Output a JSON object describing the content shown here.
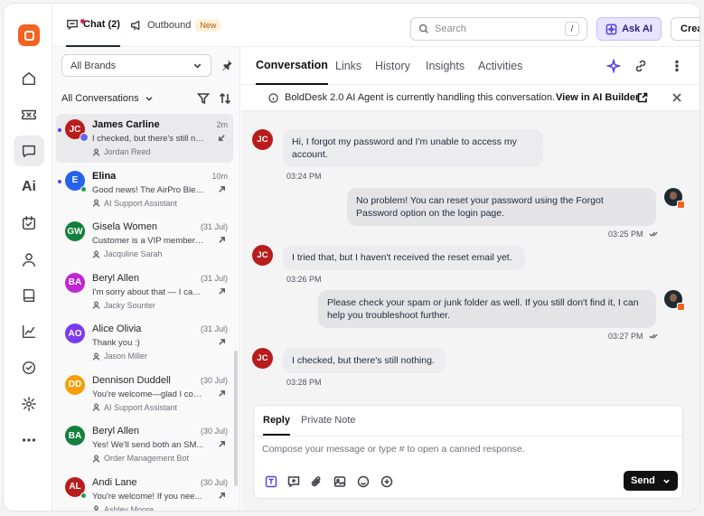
{
  "header": {
    "chat_tab": "Chat (2)",
    "outbound_tab": "Outbound",
    "outbound_badge": "New",
    "search_placeholder": "Search",
    "search_shortcut": "/",
    "ask_ai": "Ask AI",
    "create": "Create"
  },
  "sidebar_icons": [
    "home-icon",
    "ticket-icon",
    "chat-icon",
    "ai-icon",
    "tasks-icon",
    "contacts-icon",
    "knowledge-base-icon",
    "reports-icon",
    "approvals-icon",
    "settings-icon",
    "more-icon"
  ],
  "sidebar_ai_label": "Ai",
  "list": {
    "brand_filter": "All Brands",
    "view": "All Conversations",
    "items": [
      {
        "initials": "JC",
        "name": "James Carline",
        "time": "2m",
        "preview": "I checked, but there's still not...",
        "agent": "Jordan Reed",
        "color": "#b91c1c",
        "unread": true,
        "selected": true
      },
      {
        "initials": "E",
        "name": "Elina",
        "time": "10m",
        "preview": "Good news! The AirPro Blen...",
        "agent": "AI Support Assistant",
        "color": "#2563eb",
        "unread": true,
        "selected": false
      },
      {
        "initials": "GW",
        "name": "Gisela Women",
        "time": "(31 Jul)",
        "preview": "Customer is a VIP members...",
        "agent": "Jacquline Sarah",
        "color": "#15803d",
        "unread": false,
        "selected": false
      },
      {
        "initials": "BA",
        "name": "Beryl Allen",
        "time": "(31 Jul)",
        "preview": "I'm sorry about that — I can...",
        "agent": "Jacky Sounter",
        "color": "#c026d3",
        "unread": false,
        "selected": false
      },
      {
        "initials": "AO",
        "name": "Alice Olivia",
        "time": "(31 Jul)",
        "preview": "Thank you :)",
        "agent": "Jason Miller",
        "color": "#7c3aed",
        "unread": false,
        "selected": false
      },
      {
        "initials": "DD",
        "name": "Dennison Duddell",
        "time": "(30 Jul)",
        "preview": "You're welcome—glad I cou...",
        "agent": "AI Support Assistant",
        "color": "#f59e0b",
        "unread": false,
        "selected": false
      },
      {
        "initials": "BA",
        "name": "Beryl Allen",
        "time": "(30 Jul)",
        "preview": "Yes! We'll send both an SM...",
        "agent": "Order Management Bot",
        "color": "#15803d",
        "unread": false,
        "selected": false
      },
      {
        "initials": "AL",
        "name": "Andi Lane",
        "time": "(30 Jul)",
        "preview": "You're welcome! If you nee...",
        "agent": "Ashley Moore",
        "color": "#b91c1c",
        "unread": false,
        "selected": false
      }
    ]
  },
  "tabs": [
    "Conversation",
    "Links",
    "History",
    "Insights",
    "Activities"
  ],
  "banner": {
    "text": "BoldDesk 2.0 AI Agent is currently handling this conversation.",
    "link": "View in AI Builder"
  },
  "messages": [
    {
      "from": "customer",
      "initials": "JC",
      "text": "Hi, I forgot my password and I'm unable to access my account.",
      "time": "03:24 PM"
    },
    {
      "from": "agent",
      "text": "No problem! You can reset your password using the Forgot Password option on the login page.",
      "time": "03:25 PM"
    },
    {
      "from": "customer",
      "initials": "JC",
      "text": "I tried that, but I haven't received the reset email yet.",
      "time": "03:26 PM"
    },
    {
      "from": "agent",
      "text": "Please check your spam or junk folder as well. If you still don't find it, I can help you troubleshoot further.",
      "time": "03:27 PM"
    },
    {
      "from": "customer",
      "initials": "JC",
      "text": "I checked, but there's still nothing.",
      "time": "03:28 PM"
    }
  ],
  "composer": {
    "reply_tab": "Reply",
    "note_tab": "Private Note",
    "placeholder": "Compose your message or type # to open a canned response.",
    "send": "Send"
  }
}
